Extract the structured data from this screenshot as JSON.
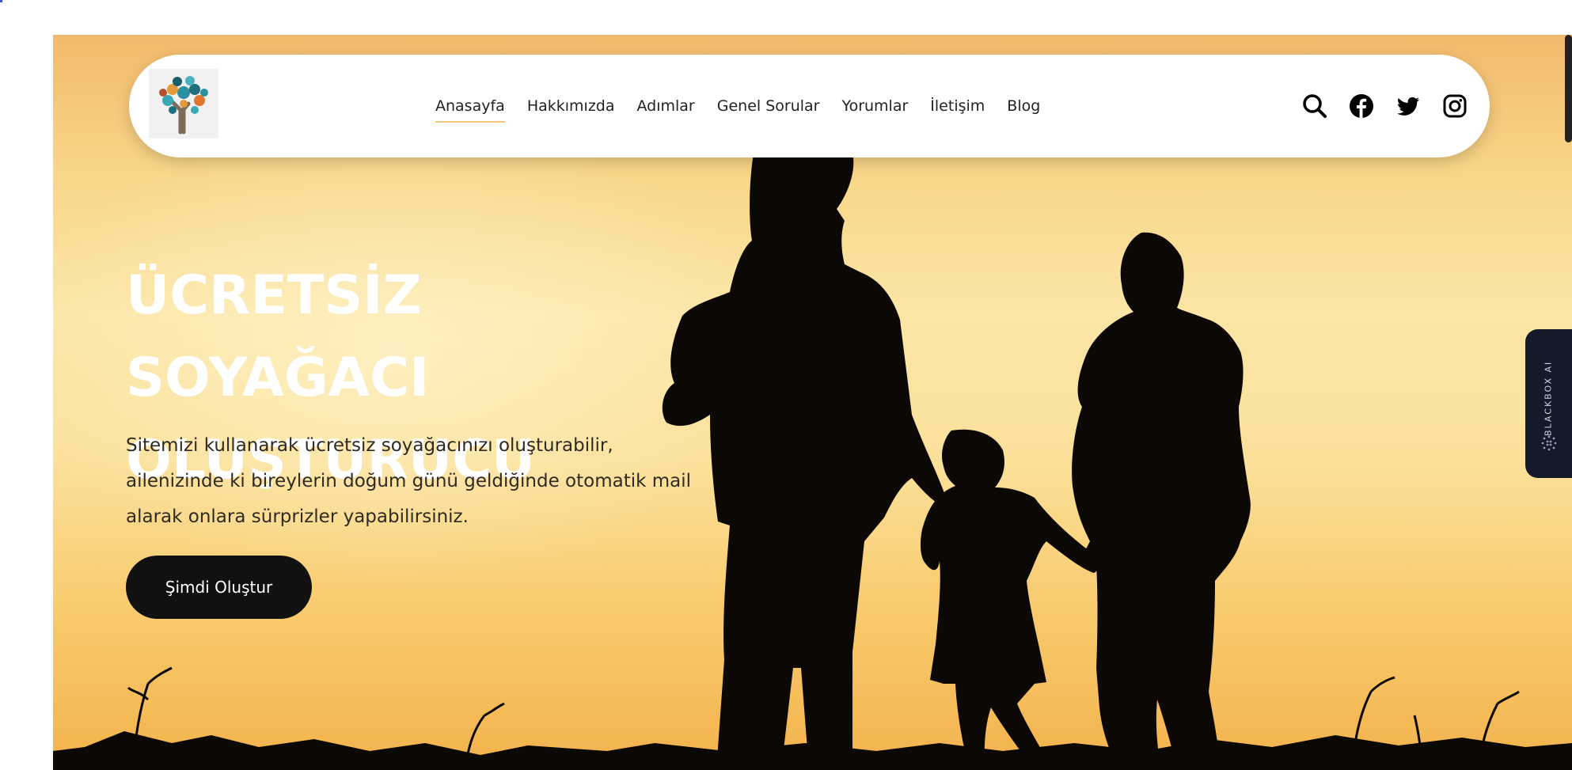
{
  "nav": {
    "logo_alt": "Soyağacı logo",
    "items": [
      {
        "label": "Anasayfa",
        "active": true
      },
      {
        "label": "Hakkımızda",
        "active": false
      },
      {
        "label": "Adımlar",
        "active": false
      },
      {
        "label": "Genel Sorular",
        "active": false
      },
      {
        "label": "Yorumlar",
        "active": false
      },
      {
        "label": "İletişim",
        "active": false
      },
      {
        "label": "Blog",
        "active": false
      }
    ],
    "icons": [
      "search-icon",
      "facebook-icon",
      "twitter-icon",
      "instagram-icon"
    ],
    "active_underline_color": "#f4c77d"
  },
  "hero": {
    "title_line1": "ÜCRETSİZ SOYAĞACI",
    "title_line2": "OLUŞTURUCU",
    "description": "Sitemizi kullanarak ücretsiz soyağacınızı oluşturabilir, ailenizinde ki bireylerin doğum günü geldiğinde otomatik mail alarak onlara sürprizler yapabilirsiniz.",
    "cta_label": "Şimdi Oluştur",
    "background_colors": [
      "#f2b96c",
      "#fbe6a6",
      "#f3b24c"
    ]
  },
  "side_widget": {
    "label": "BLACKBOX AI",
    "color": "#141a2a"
  }
}
